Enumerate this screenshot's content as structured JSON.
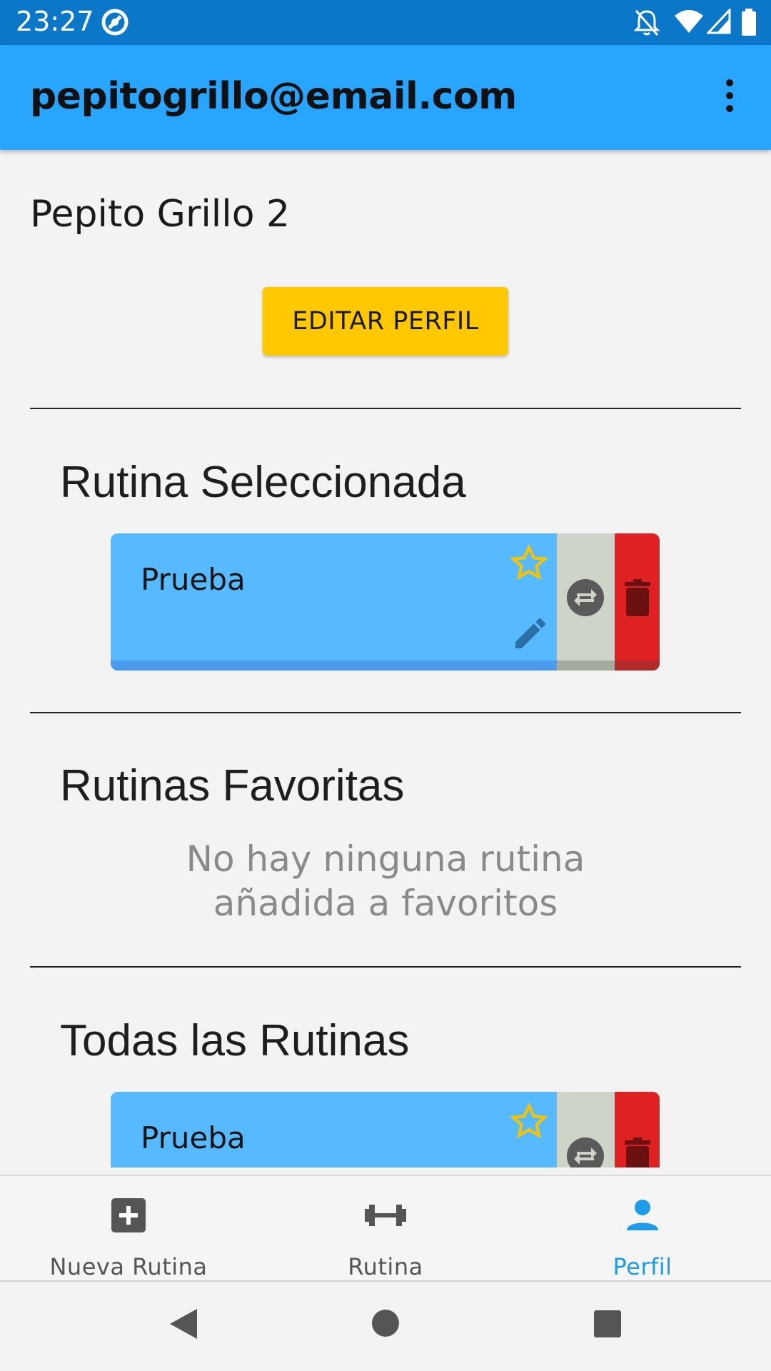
{
  "status_bar": {
    "time": "23:27"
  },
  "app_bar": {
    "title": "pepitogrillo@email.com"
  },
  "profile": {
    "name": "Pepito Grillo 2",
    "edit_button": "EDITAR PERFIL"
  },
  "sections": {
    "selected": {
      "title": "Rutina Seleccionada",
      "routine_name": "Prueba"
    },
    "favorites": {
      "title": "Rutinas Favoritas",
      "empty_line1": "No hay ninguna rutina",
      "empty_line2": "añadida a favoritos"
    },
    "all": {
      "title": "Todas las Rutinas",
      "routine_name": "Prueba"
    }
  },
  "bottom_nav": {
    "items": [
      {
        "label": "Nueva Rutina",
        "icon": "add-box-icon"
      },
      {
        "label": "Rutina",
        "icon": "dumbbell-icon"
      },
      {
        "label": "Perfil",
        "icon": "person-icon",
        "active": true
      }
    ]
  },
  "colors": {
    "app_bar": "#27a5ff",
    "status_bar": "#0a77c9",
    "edit_button": "#ffc800",
    "card": "#57baff",
    "swap": "#ced4c7",
    "delete": "#e02121",
    "star": "#f5c400",
    "active_nav": "#1e9be9"
  }
}
